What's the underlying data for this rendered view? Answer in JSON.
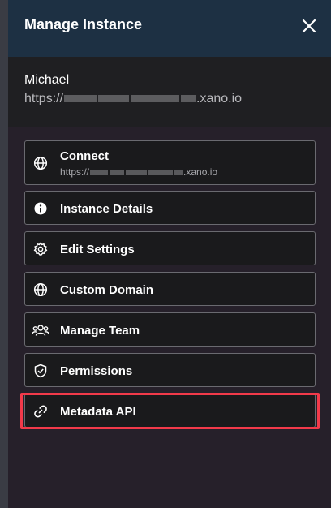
{
  "header": {
    "title": "Manage Instance",
    "close_icon": "close-icon"
  },
  "instance": {
    "name": "Michael",
    "url_prefix": "https://",
    "url_suffix": ".xano.io"
  },
  "menu": {
    "items": [
      {
        "label": "Connect",
        "sub_prefix": "https://",
        "sub_suffix": ".xano.io",
        "icon": "globe-icon"
      },
      {
        "label": "Instance Details",
        "icon": "info-icon"
      },
      {
        "label": "Edit Settings",
        "icon": "gear-icon"
      },
      {
        "label": "Custom Domain",
        "icon": "globe-icon"
      },
      {
        "label": "Manage Team",
        "icon": "users-icon"
      },
      {
        "label": "Permissions",
        "icon": "shield-check-icon"
      },
      {
        "label": "Metadata API",
        "icon": "link-icon"
      }
    ]
  },
  "colors": {
    "header_bg": "#1d3043",
    "highlight": "#f23a4a",
    "item_border": "#6a6a70"
  }
}
